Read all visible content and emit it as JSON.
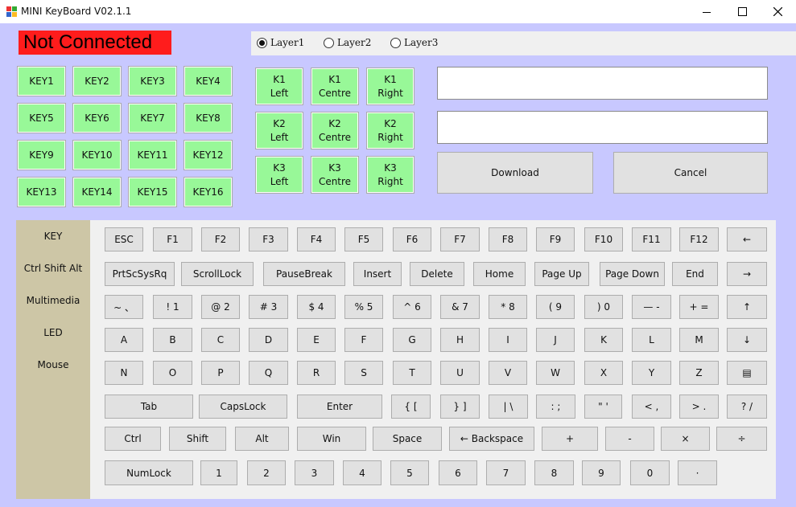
{
  "window": {
    "title": "MINI KeyBoard V02.1.1",
    "icon": "app-icon",
    "minimize_icon": "minimize-icon",
    "maximize_icon": "maximize-icon",
    "close_icon": "close-icon"
  },
  "status": {
    "text": "Not Connected",
    "color": "#ff1c1c"
  },
  "layers": [
    {
      "label": "Layer1",
      "selected": true
    },
    {
      "label": "Layer2",
      "selected": false
    },
    {
      "label": "Layer3",
      "selected": false
    }
  ],
  "key_grid": [
    "KEY1",
    "KEY2",
    "KEY3",
    "KEY4",
    "KEY5",
    "KEY6",
    "KEY7",
    "KEY8",
    "KEY9",
    "KEY10",
    "KEY11",
    "KEY12",
    "KEY13",
    "KEY14",
    "KEY15",
    "KEY16"
  ],
  "knob_grid": [
    "K1\nLeft",
    "K1\nCentre",
    "K1\nRight",
    "K2\nLeft",
    "K2\nCentre",
    "K2\nRight",
    "K3\nLeft",
    "K3\nCentre",
    "K3\nRight"
  ],
  "inputs": [
    {
      "value": ""
    },
    {
      "value": ""
    }
  ],
  "actions": {
    "download": "Download",
    "cancel": "Cancel"
  },
  "categories": [
    "KEY",
    "Ctrl Shift Alt",
    "Multimedia",
    "LED",
    "Mouse"
  ],
  "keyboard_rows": [
    [
      "ESC",
      "F1",
      "F2",
      "F3",
      "F4",
      "F5",
      "F6",
      "F7",
      "F8",
      "F9",
      "F10",
      "F11",
      "F12",
      "←"
    ],
    [
      "PrtScSysRq",
      "ScrollLock",
      "PauseBreak",
      "Insert",
      "Delete",
      "Home",
      "Page Up",
      "Page Down",
      "End",
      "→"
    ],
    [
      "~ 、",
      "! 1",
      "@ 2",
      "# 3",
      "$ 4",
      "% 5",
      "^ 6",
      "& 7",
      "* 8",
      "( 9",
      ") 0",
      "— -",
      "+ =",
      "↑"
    ],
    [
      "A",
      "B",
      "C",
      "D",
      "E",
      "F",
      "G",
      "H",
      "I",
      "J",
      "K",
      "L",
      "M",
      "↓"
    ],
    [
      "N",
      "O",
      "P",
      "Q",
      "R",
      "S",
      "T",
      "U",
      "V",
      "W",
      "X",
      "Y",
      "Z",
      "▤"
    ],
    [
      "Tab",
      "CapsLock",
      "Enter",
      "{ [",
      "} ]",
      "| \\",
      ": ;",
      "\" '",
      "< ,",
      "> .",
      "? /"
    ],
    [
      "Ctrl",
      "Shift",
      "Alt",
      "Win",
      "Space",
      "← Backspace",
      "+",
      "-",
      "×",
      "÷"
    ],
    [
      "NumLock",
      "1",
      "2",
      "3",
      "4",
      "5",
      "6",
      "7",
      "8",
      "9",
      "0",
      "·"
    ]
  ],
  "colors": {
    "background": "#c8c8ff",
    "key_green": "#98f898",
    "panel": "#f0f0f0",
    "side_panel": "#cdc6a6"
  }
}
